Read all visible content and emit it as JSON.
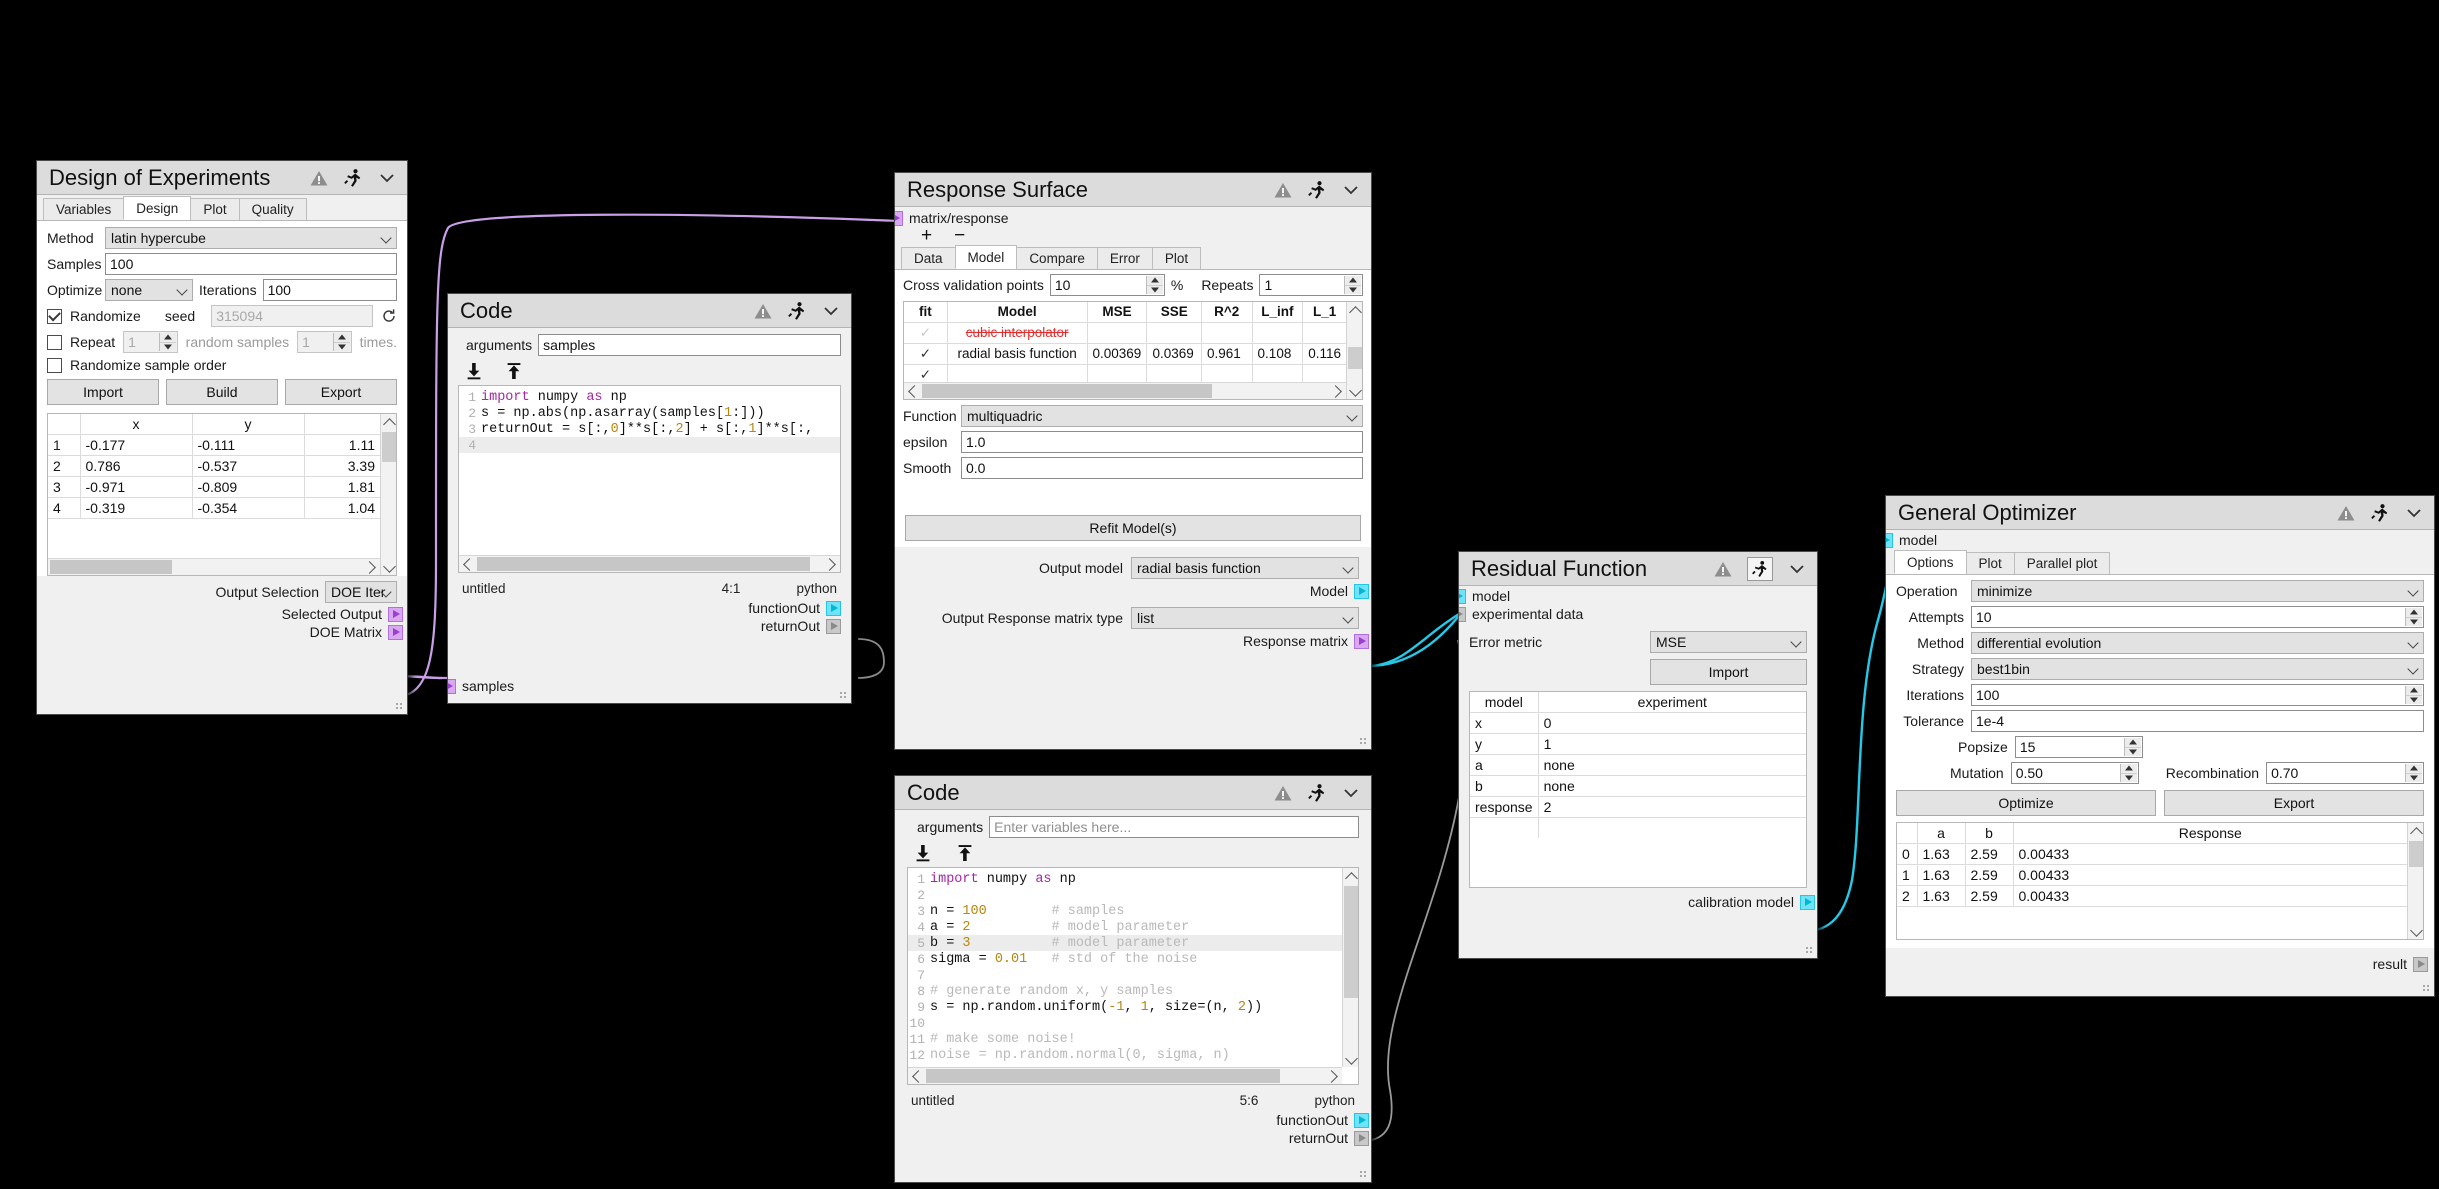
{
  "doe": {
    "title": "Design of Experiments",
    "tabs": [
      "Variables",
      "Design",
      "Plot",
      "Quality"
    ],
    "active_tab": "Design",
    "method_label": "Method",
    "method_value": "latin hypercube",
    "samples_label": "Samples",
    "samples_value": "100",
    "optimize_label": "Optimize",
    "optimize_value": "none",
    "iterations_label": "Iterations",
    "iterations_value": "100",
    "randomize_label": "Randomize",
    "seed_label": "seed",
    "seed_value": "315094",
    "repeat_label": "Repeat",
    "repeat_value": "1",
    "random_samples_label": "random samples",
    "random_samples_value": "1",
    "times_label": "times.",
    "randomize_order_label": "Randomize sample order",
    "import_label": "Import",
    "build_label": "Build",
    "export_label": "Export",
    "table": {
      "headers": [
        "",
        "x",
        "y",
        ""
      ],
      "rows": [
        [
          "1",
          "-0.177",
          "-0.111",
          "1.11"
        ],
        [
          "2",
          "0.786",
          "-0.537",
          "3.39"
        ],
        [
          "3",
          "-0.971",
          "-0.809",
          "1.81"
        ],
        [
          "4",
          "-0.319",
          "-0.354",
          "1.04"
        ]
      ]
    },
    "output_selection_label": "Output Selection",
    "output_selection_value": "DOE Iter",
    "selected_output_label": "Selected Output",
    "doe_matrix_label": "DOE Matrix"
  },
  "code_top": {
    "title": "Code",
    "arguments_label": "arguments",
    "arguments_value": "samples",
    "arguments_placeholder": "",
    "lines": [
      {
        "n": "1",
        "tokens": [
          {
            "t": "import ",
            "c": "k"
          },
          {
            "t": "numpy ",
            "c": "t"
          },
          {
            "t": "as ",
            "c": "k"
          },
          {
            "t": "np",
            "c": "t"
          }
        ]
      },
      {
        "n": "2",
        "tokens": [
          {
            "t": "s = np.abs(np.asarray(samples[",
            "c": "t"
          },
          {
            "t": "1",
            "c": "n"
          },
          {
            "t": ":]))",
            "c": "t"
          }
        ]
      },
      {
        "n": "3",
        "tokens": [
          {
            "t": "returnOut = s[:,",
            "c": "t"
          },
          {
            "t": "0",
            "c": "n"
          },
          {
            "t": "]**s[:,",
            "c": "t"
          },
          {
            "t": "2",
            "c": "n"
          },
          {
            "t": "] + s[:,",
            "c": "t"
          },
          {
            "t": "1",
            "c": "n"
          },
          {
            "t": "]**s[:,",
            "c": "t"
          }
        ]
      },
      {
        "n": "4",
        "tokens": [
          {
            "t": "",
            "c": "t"
          }
        ],
        "hl": true
      }
    ],
    "filename": "untitled",
    "cursor": "4:1",
    "language": "python",
    "out_function": "functionOut",
    "out_return": "returnOut",
    "in_samples": "samples"
  },
  "code_bottom": {
    "title": "Code",
    "arguments_label": "arguments",
    "arguments_value": "",
    "arguments_placeholder": "Enter variables here...",
    "lines": [
      {
        "n": "1",
        "tokens": [
          {
            "t": "import ",
            "c": "k"
          },
          {
            "t": "numpy ",
            "c": "t"
          },
          {
            "t": "as ",
            "c": "k"
          },
          {
            "t": "np",
            "c": "t"
          }
        ]
      },
      {
        "n": "2",
        "tokens": [
          {
            "t": "",
            "c": "t"
          }
        ]
      },
      {
        "n": "3",
        "tokens": [
          {
            "t": "n = ",
            "c": "t"
          },
          {
            "t": "100",
            "c": "n"
          },
          {
            "t": "         ",
            "c": "t"
          },
          {
            "t": "# samples",
            "c": "c"
          }
        ]
      },
      {
        "n": "4",
        "tokens": [
          {
            "t": "a = ",
            "c": "t"
          },
          {
            "t": "2",
            "c": "n"
          },
          {
            "t": "           ",
            "c": "t"
          },
          {
            "t": "# model parameter",
            "c": "c"
          }
        ]
      },
      {
        "n": "5",
        "tokens": [
          {
            "t": "b = ",
            "c": "t"
          },
          {
            "t": "3",
            "c": "n"
          },
          {
            "t": "           ",
            "c": "t"
          },
          {
            "t": "# model parameter",
            "c": "c"
          }
        ],
        "hl": true
      },
      {
        "n": "6",
        "tokens": [
          {
            "t": "sigma = ",
            "c": "t"
          },
          {
            "t": "0.01",
            "c": "n"
          },
          {
            "t": "    ",
            "c": "t"
          },
          {
            "t": "# std of the noise",
            "c": "c"
          }
        ]
      },
      {
        "n": "7",
        "tokens": [
          {
            "t": "",
            "c": "t"
          }
        ]
      },
      {
        "n": "8",
        "tokens": [
          {
            "t": "# generate random x, y samples",
            "c": "c"
          }
        ]
      },
      {
        "n": "9",
        "tokens": [
          {
            "t": "s = np.random.uniform(",
            "c": "t"
          },
          {
            "t": "-1",
            "c": "n"
          },
          {
            "t": ", ",
            "c": "t"
          },
          {
            "t": "1",
            "c": "n"
          },
          {
            "t": ", size=(n, ",
            "c": "t"
          },
          {
            "t": "2",
            "c": "n"
          },
          {
            "t": "))",
            "c": "t"
          }
        ]
      },
      {
        "n": "10",
        "tokens": [
          {
            "t": "",
            "c": "t"
          }
        ]
      },
      {
        "n": "11",
        "tokens": [
          {
            "t": "# make some noise!",
            "c": "c"
          }
        ]
      },
      {
        "n": "12",
        "tokens": [
          {
            "t": "noise = np.random.normal(",
            "c": "c"
          },
          {
            "t": "0, sigma, n)",
            "c": "c"
          }
        ]
      }
    ],
    "filename": "untitled",
    "cursor": "5:6",
    "language": "python",
    "out_function": "functionOut",
    "out_return": "returnOut"
  },
  "response_surface": {
    "title": "Response Surface",
    "input_port_label": "matrix/response",
    "add_label": "+",
    "remove_label": "−",
    "tabs": [
      "Data",
      "Model",
      "Compare",
      "Error",
      "Plot"
    ],
    "active_tab": "Model",
    "cv_points_label": "Cross validation points",
    "cv_points_value": "10",
    "percent_label": "%",
    "repeats_label": "Repeats",
    "repeats_value": "1",
    "table": {
      "headers": [
        "fit",
        "Model",
        "MSE",
        "SSE",
        "R^2",
        "L_inf",
        "L_1"
      ],
      "rows": [
        {
          "fit": "check-dim",
          "model": "cubic interpolator",
          "strike": true,
          "mse": "",
          "sse": "",
          "r2": "",
          "linf": "",
          "l1": ""
        },
        {
          "fit": "check",
          "model": "radial basis function",
          "strike": false,
          "mse": "0.00369",
          "sse": "0.0369",
          "r2": "0.961",
          "linf": "0.108",
          "l1": "0.116"
        }
      ]
    },
    "function_label": "Function",
    "function_value": "multiquadric",
    "epsilon_label": "epsilon",
    "epsilon_value": "1.0",
    "smooth_label": "Smooth",
    "smooth_value": "0.0",
    "refit_label": "Refit Model(s)",
    "output_model_label": "Output model",
    "output_model_value": "radial basis function",
    "model_port_label": "Model",
    "output_matrix_type_label": "Output Response matrix type",
    "output_matrix_type_value": "list",
    "response_matrix_label": "Response matrix"
  },
  "residual": {
    "title": "Residual Function",
    "in_model": "model",
    "in_experimental": "experimental data",
    "error_metric_label": "Error metric",
    "error_metric_value": "MSE",
    "import_label": "Import",
    "table": {
      "headers": [
        "model",
        "experiment"
      ],
      "rows": [
        [
          "x",
          "0"
        ],
        [
          "y",
          "1"
        ],
        [
          "a",
          "none"
        ],
        [
          "b",
          "none"
        ],
        [
          "response",
          "2"
        ]
      ]
    },
    "out_calibration": "calibration model"
  },
  "optimizer": {
    "title": "General Optimizer",
    "in_model": "model",
    "tabs": [
      "Options",
      "Plot",
      "Parallel plot"
    ],
    "active_tab": "Options",
    "operation_label": "Operation",
    "operation_value": "minimize",
    "attempts_label": "Attempts",
    "attempts_value": "10",
    "method_label": "Method",
    "method_value": "differential evolution",
    "strategy_label": "Strategy",
    "strategy_value": "best1bin",
    "iterations_label": "Iterations",
    "iterations_value": "100",
    "tolerance_label": "Tolerance",
    "tolerance_value": "1e-4",
    "popsize_label": "Popsize",
    "popsize_value": "15",
    "mutation_label": "Mutation",
    "mutation_value": "0.50",
    "recombination_label": "Recombination",
    "recombination_value": "0.70",
    "optimize_label": "Optimize",
    "export_label": "Export",
    "table": {
      "headers": [
        "",
        "a",
        "b",
        "Response"
      ],
      "rows": [
        [
          "0",
          "1.63",
          "2.59",
          "0.00433"
        ],
        [
          "1",
          "1.63",
          "2.59",
          "0.00433"
        ],
        [
          "2",
          "1.63",
          "2.59",
          "0.00433"
        ]
      ]
    },
    "result_label": "result"
  },
  "colors": {
    "wire_magenta": "#c9a0e8",
    "wire_cyan": "#25c9e8",
    "wire_gray": "#9a9a9a",
    "port_cyan": "#6fe3f7",
    "port_magenta": "#d9a8f0",
    "strike_red": "#e03030",
    "canvas_bg": "#000000"
  }
}
